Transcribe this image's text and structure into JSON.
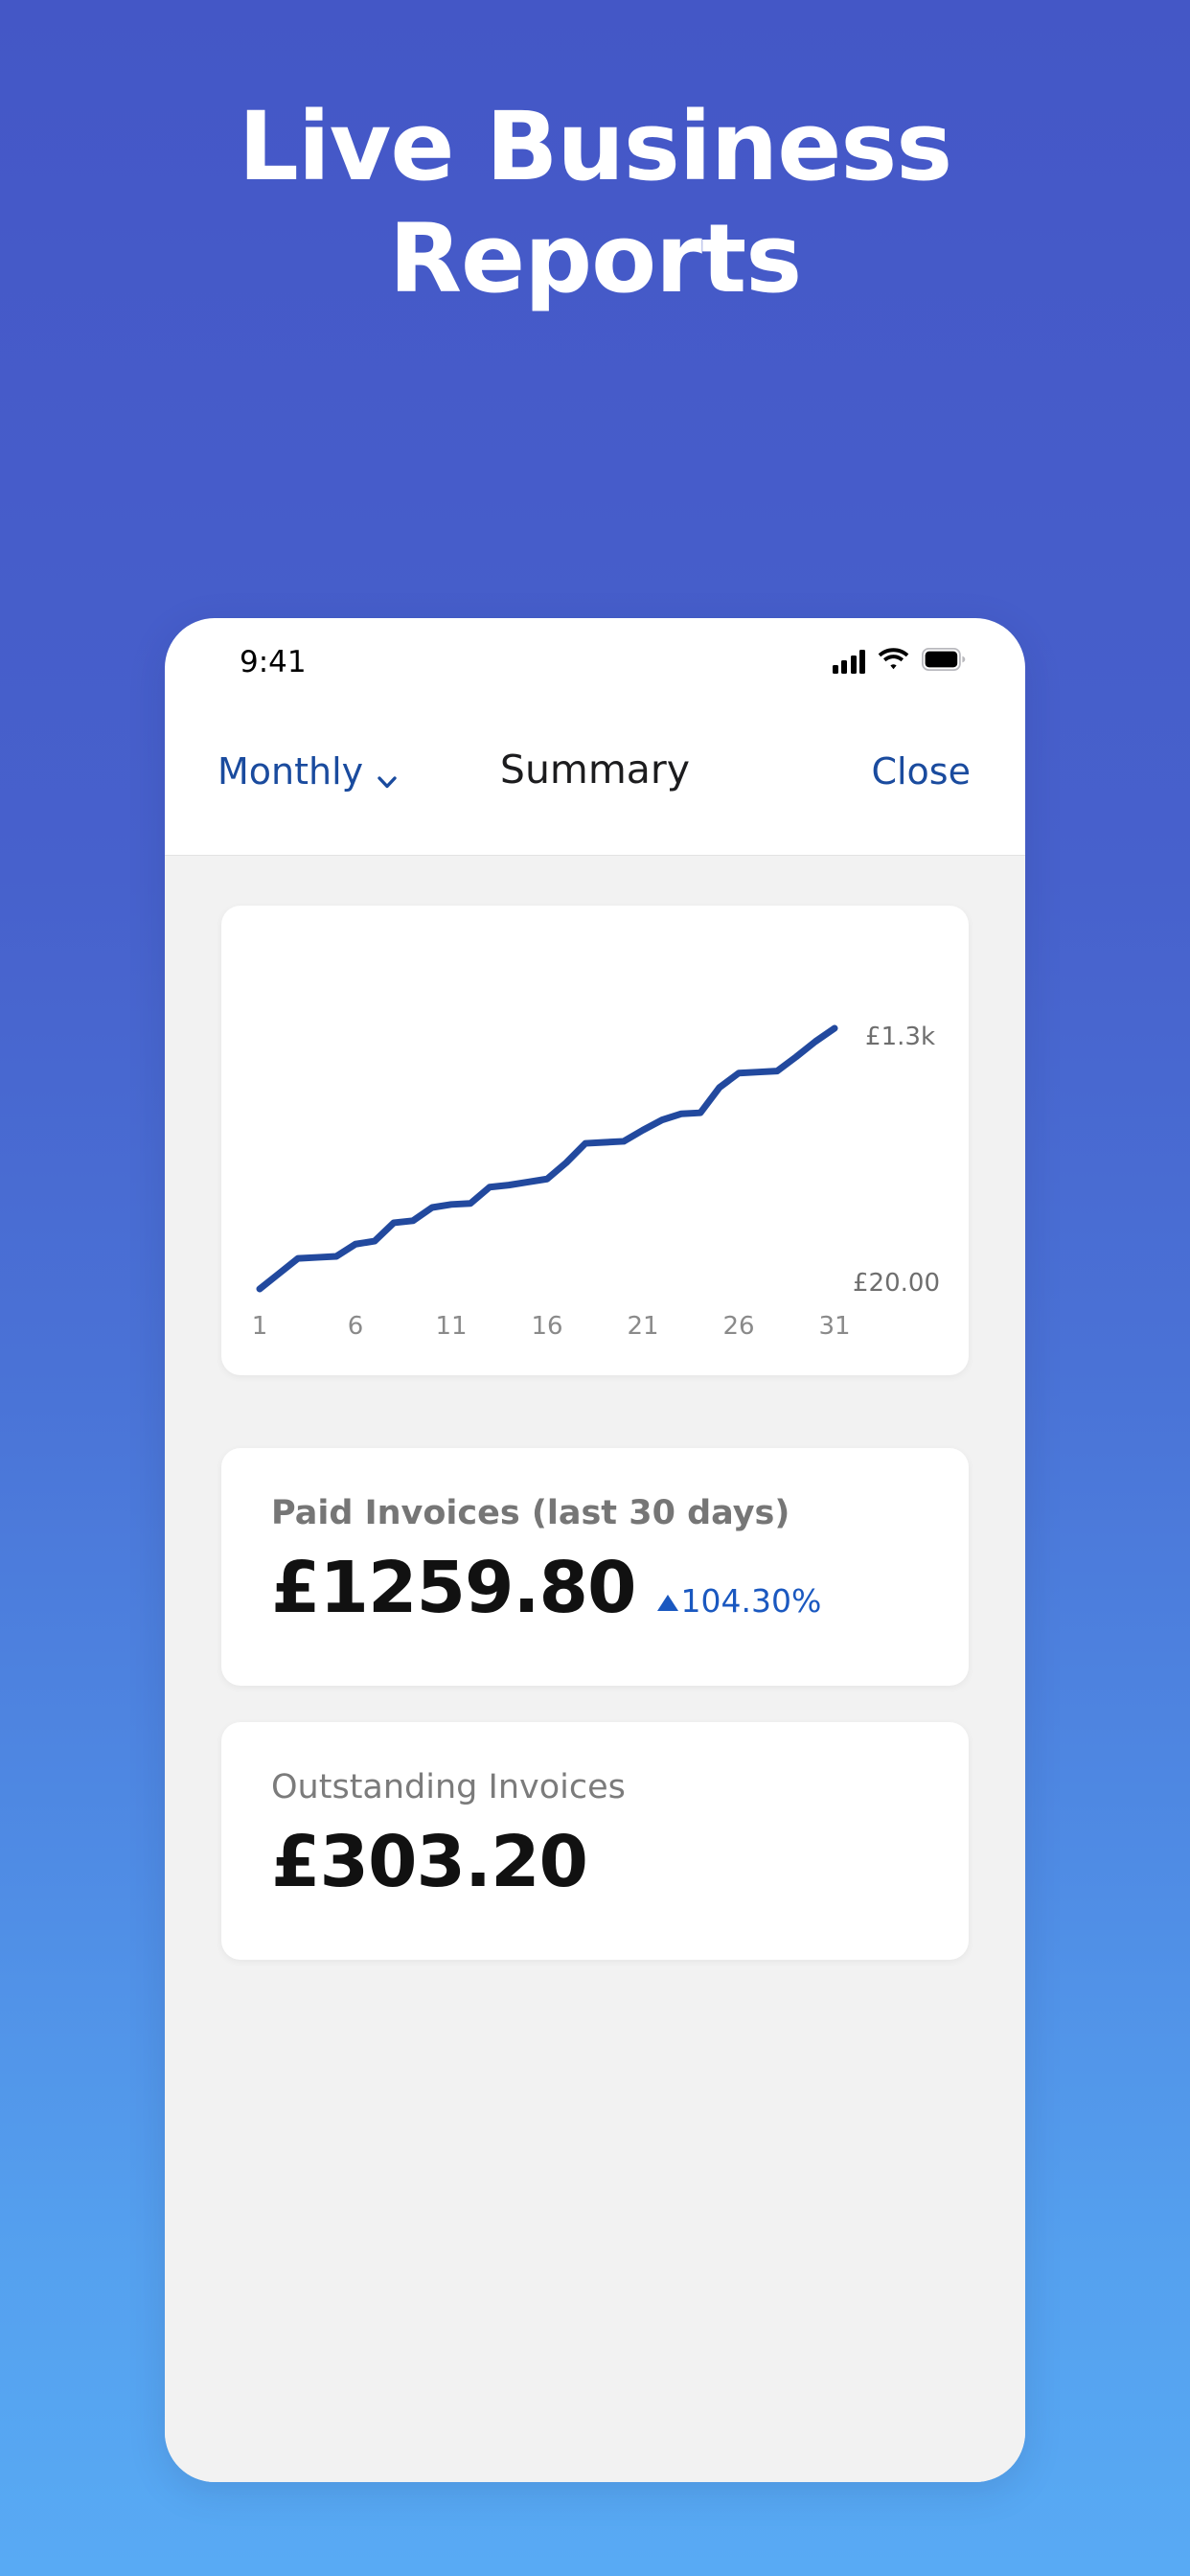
{
  "hero": {
    "headline": "Live Business\nReports",
    "bg_top_color": "#4457C6",
    "bg_bottom_color": "#58AAF4"
  },
  "phone": {
    "statusbar": {
      "time": "9:41",
      "signal_icon": "cellular-signal-icon",
      "wifi_icon": "wifi-icon",
      "battery_icon": "battery-full-icon"
    },
    "navbar": {
      "period_label": "Monthly",
      "period_chevron": "chevron-down-icon",
      "title": "Summary",
      "close_label": "Close",
      "accent_color": "#1A4B9E"
    },
    "cards": {
      "paid": {
        "title": "Paid Invoices (last 30 days)",
        "value": "£1259.80",
        "delta": "104.30%",
        "delta_direction": "up",
        "delta_color": "#1A58C0"
      },
      "outstanding": {
        "title": "Outstanding Invoices",
        "value": "£303.20"
      }
    }
  },
  "chart_data": {
    "type": "line",
    "title": "",
    "xlabel": "",
    "ylabel": "",
    "line_color": "#22499E",
    "grid": false,
    "legend": false,
    "x_tick_labels": [
      "1",
      "6",
      "11",
      "16",
      "21",
      "26",
      "31"
    ],
    "x_ticks": [
      1,
      6,
      11,
      16,
      21,
      26,
      31
    ],
    "xlim": [
      1,
      31
    ],
    "ylim": [
      20,
      1300
    ],
    "y_axis_max_label": "£1.3k",
    "y_axis_min_label": "£20.00",
    "x": [
      1,
      2,
      3,
      4,
      5,
      6,
      7,
      8,
      9,
      10,
      11,
      12,
      13,
      14,
      15,
      16,
      17,
      18,
      19,
      20,
      21,
      22,
      23,
      24,
      25,
      26,
      27,
      28,
      29,
      30,
      31
    ],
    "values": [
      20,
      95,
      170,
      175,
      180,
      240,
      255,
      345,
      355,
      420,
      435,
      440,
      520,
      530,
      545,
      560,
      640,
      735,
      740,
      745,
      800,
      850,
      880,
      885,
      1010,
      1080,
      1085,
      1090,
      1160,
      1235,
      1300
    ]
  }
}
